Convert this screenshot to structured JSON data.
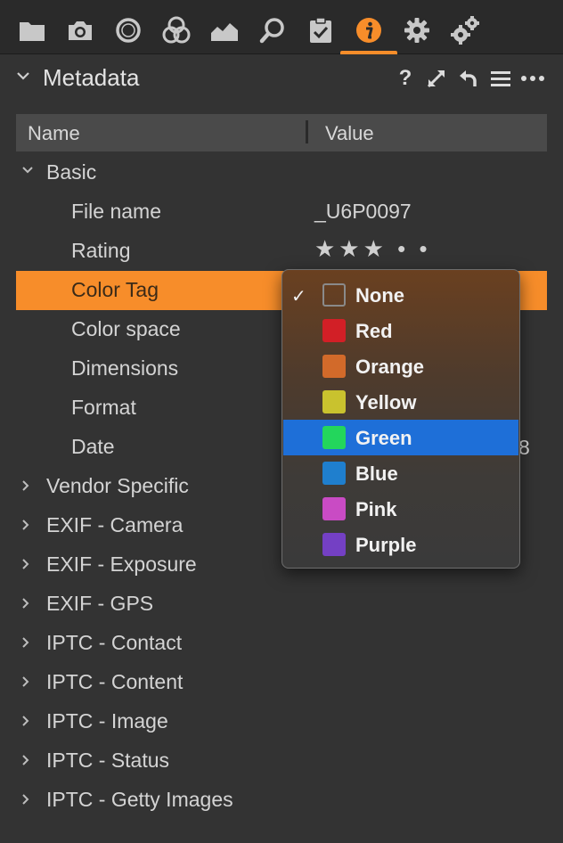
{
  "toolbar": {
    "tabs": [
      {
        "icon": "folder-icon"
      },
      {
        "icon": "camera-icon"
      },
      {
        "icon": "lens-icon"
      },
      {
        "icon": "color-circles-icon"
      },
      {
        "icon": "exposure-histogram-icon"
      },
      {
        "icon": "search-loupe-icon"
      },
      {
        "icon": "clipboard-check-icon"
      },
      {
        "icon": "info-icon",
        "active": true
      },
      {
        "icon": "gear-icon"
      },
      {
        "icon": "gears-icon"
      }
    ],
    "accent_color": "#f78d2a"
  },
  "panel": {
    "title": "Metadata",
    "help_label": "?"
  },
  "table": {
    "col_name": "Name",
    "col_value": "Value"
  },
  "rows": {
    "basic": "Basic",
    "file_name": "File name",
    "file_name_value": "_U6P0097",
    "rating": "Rating",
    "rating_value": "★★★ • •",
    "color_tag": "Color Tag",
    "color_space": "Color space",
    "dimensions": "Dimensions",
    "format": "Format",
    "date": "Date",
    "date_value_peek": "8",
    "vendor": "Vendor Specific",
    "exif_camera": "EXIF - Camera",
    "exif_exposure": "EXIF - Exposure",
    "exif_gps": "EXIF - GPS",
    "iptc_contact": "IPTC - Contact",
    "iptc_content": "IPTC - Content",
    "iptc_image": "IPTC - Image",
    "iptc_status": "IPTC - Status",
    "iptc_getty": "IPTC - Getty Images"
  },
  "color_menu": {
    "check_mark": "✓",
    "options": [
      {
        "label": "None",
        "color": "transparent",
        "checked": true
      },
      {
        "label": "Red",
        "color": "#d21f26"
      },
      {
        "label": "Orange",
        "color": "#d26a2a"
      },
      {
        "label": "Yellow",
        "color": "#c9c22e"
      },
      {
        "label": "Green",
        "color": "#23d65c",
        "highlighted": true
      },
      {
        "label": "Blue",
        "color": "#1f7fce"
      },
      {
        "label": "Pink",
        "color": "#c94bc4"
      },
      {
        "label": "Purple",
        "color": "#7440c4"
      }
    ]
  }
}
